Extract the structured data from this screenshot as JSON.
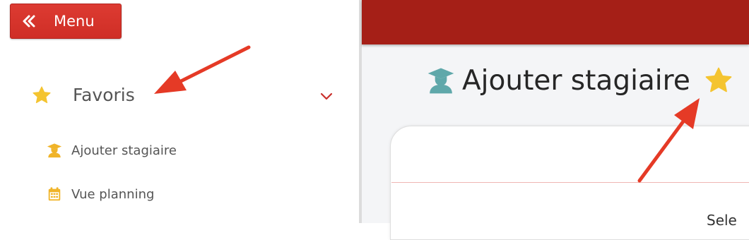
{
  "sidebar": {
    "menu_button": {
      "label": "Menu",
      "icon": "double-chevron-left-icon"
    },
    "favorites": {
      "label": "Favoris",
      "icon": "star-icon",
      "toggle_icon": "chevron-down-icon",
      "items": [
        {
          "label": "Ajouter stagiaire",
          "icon": "graduate-icon"
        },
        {
          "label": "Vue planning",
          "icon": "calendar-icon"
        }
      ]
    }
  },
  "header": {
    "title": "Ajouter stagiaire",
    "title_icon": "graduate-icon",
    "favorite_icon": "star-icon"
  },
  "card": {
    "partial_text": "Sele"
  },
  "colors": {
    "brand_red": "#a51f17",
    "button_red": "#d9362d",
    "star_yellow": "#f4c430",
    "graduate_teal": "#5fa8aa",
    "annotation_arrow": "#e53a26"
  }
}
